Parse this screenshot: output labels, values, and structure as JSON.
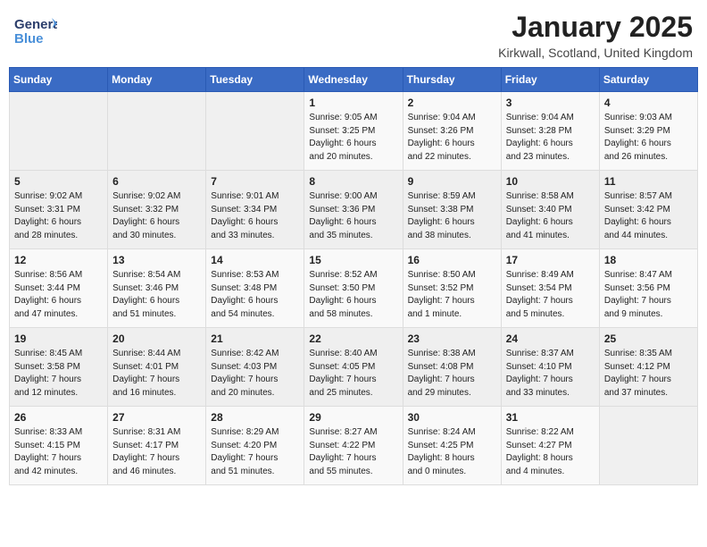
{
  "header": {
    "logo_general": "General",
    "logo_blue": "Blue",
    "month": "January 2025",
    "location": "Kirkwall, Scotland, United Kingdom"
  },
  "weekdays": [
    "Sunday",
    "Monday",
    "Tuesday",
    "Wednesday",
    "Thursday",
    "Friday",
    "Saturday"
  ],
  "weeks": [
    [
      {
        "day": "",
        "info": ""
      },
      {
        "day": "",
        "info": ""
      },
      {
        "day": "",
        "info": ""
      },
      {
        "day": "1",
        "info": "Sunrise: 9:05 AM\nSunset: 3:25 PM\nDaylight: 6 hours\nand 20 minutes."
      },
      {
        "day": "2",
        "info": "Sunrise: 9:04 AM\nSunset: 3:26 PM\nDaylight: 6 hours\nand 22 minutes."
      },
      {
        "day": "3",
        "info": "Sunrise: 9:04 AM\nSunset: 3:28 PM\nDaylight: 6 hours\nand 23 minutes."
      },
      {
        "day": "4",
        "info": "Sunrise: 9:03 AM\nSunset: 3:29 PM\nDaylight: 6 hours\nand 26 minutes."
      }
    ],
    [
      {
        "day": "5",
        "info": "Sunrise: 9:02 AM\nSunset: 3:31 PM\nDaylight: 6 hours\nand 28 minutes."
      },
      {
        "day": "6",
        "info": "Sunrise: 9:02 AM\nSunset: 3:32 PM\nDaylight: 6 hours\nand 30 minutes."
      },
      {
        "day": "7",
        "info": "Sunrise: 9:01 AM\nSunset: 3:34 PM\nDaylight: 6 hours\nand 33 minutes."
      },
      {
        "day": "8",
        "info": "Sunrise: 9:00 AM\nSunset: 3:36 PM\nDaylight: 6 hours\nand 35 minutes."
      },
      {
        "day": "9",
        "info": "Sunrise: 8:59 AM\nSunset: 3:38 PM\nDaylight: 6 hours\nand 38 minutes."
      },
      {
        "day": "10",
        "info": "Sunrise: 8:58 AM\nSunset: 3:40 PM\nDaylight: 6 hours\nand 41 minutes."
      },
      {
        "day": "11",
        "info": "Sunrise: 8:57 AM\nSunset: 3:42 PM\nDaylight: 6 hours\nand 44 minutes."
      }
    ],
    [
      {
        "day": "12",
        "info": "Sunrise: 8:56 AM\nSunset: 3:44 PM\nDaylight: 6 hours\nand 47 minutes."
      },
      {
        "day": "13",
        "info": "Sunrise: 8:54 AM\nSunset: 3:46 PM\nDaylight: 6 hours\nand 51 minutes."
      },
      {
        "day": "14",
        "info": "Sunrise: 8:53 AM\nSunset: 3:48 PM\nDaylight: 6 hours\nand 54 minutes."
      },
      {
        "day": "15",
        "info": "Sunrise: 8:52 AM\nSunset: 3:50 PM\nDaylight: 6 hours\nand 58 minutes."
      },
      {
        "day": "16",
        "info": "Sunrise: 8:50 AM\nSunset: 3:52 PM\nDaylight: 7 hours\nand 1 minute."
      },
      {
        "day": "17",
        "info": "Sunrise: 8:49 AM\nSunset: 3:54 PM\nDaylight: 7 hours\nand 5 minutes."
      },
      {
        "day": "18",
        "info": "Sunrise: 8:47 AM\nSunset: 3:56 PM\nDaylight: 7 hours\nand 9 minutes."
      }
    ],
    [
      {
        "day": "19",
        "info": "Sunrise: 8:45 AM\nSunset: 3:58 PM\nDaylight: 7 hours\nand 12 minutes."
      },
      {
        "day": "20",
        "info": "Sunrise: 8:44 AM\nSunset: 4:01 PM\nDaylight: 7 hours\nand 16 minutes."
      },
      {
        "day": "21",
        "info": "Sunrise: 8:42 AM\nSunset: 4:03 PM\nDaylight: 7 hours\nand 20 minutes."
      },
      {
        "day": "22",
        "info": "Sunrise: 8:40 AM\nSunset: 4:05 PM\nDaylight: 7 hours\nand 25 minutes."
      },
      {
        "day": "23",
        "info": "Sunrise: 8:38 AM\nSunset: 4:08 PM\nDaylight: 7 hours\nand 29 minutes."
      },
      {
        "day": "24",
        "info": "Sunrise: 8:37 AM\nSunset: 4:10 PM\nDaylight: 7 hours\nand 33 minutes."
      },
      {
        "day": "25",
        "info": "Sunrise: 8:35 AM\nSunset: 4:12 PM\nDaylight: 7 hours\nand 37 minutes."
      }
    ],
    [
      {
        "day": "26",
        "info": "Sunrise: 8:33 AM\nSunset: 4:15 PM\nDaylight: 7 hours\nand 42 minutes."
      },
      {
        "day": "27",
        "info": "Sunrise: 8:31 AM\nSunset: 4:17 PM\nDaylight: 7 hours\nand 46 minutes."
      },
      {
        "day": "28",
        "info": "Sunrise: 8:29 AM\nSunset: 4:20 PM\nDaylight: 7 hours\nand 51 minutes."
      },
      {
        "day": "29",
        "info": "Sunrise: 8:27 AM\nSunset: 4:22 PM\nDaylight: 7 hours\nand 55 minutes."
      },
      {
        "day": "30",
        "info": "Sunrise: 8:24 AM\nSunset: 4:25 PM\nDaylight: 8 hours\nand 0 minutes."
      },
      {
        "day": "31",
        "info": "Sunrise: 8:22 AM\nSunset: 4:27 PM\nDaylight: 8 hours\nand 4 minutes."
      },
      {
        "day": "",
        "info": ""
      }
    ]
  ]
}
